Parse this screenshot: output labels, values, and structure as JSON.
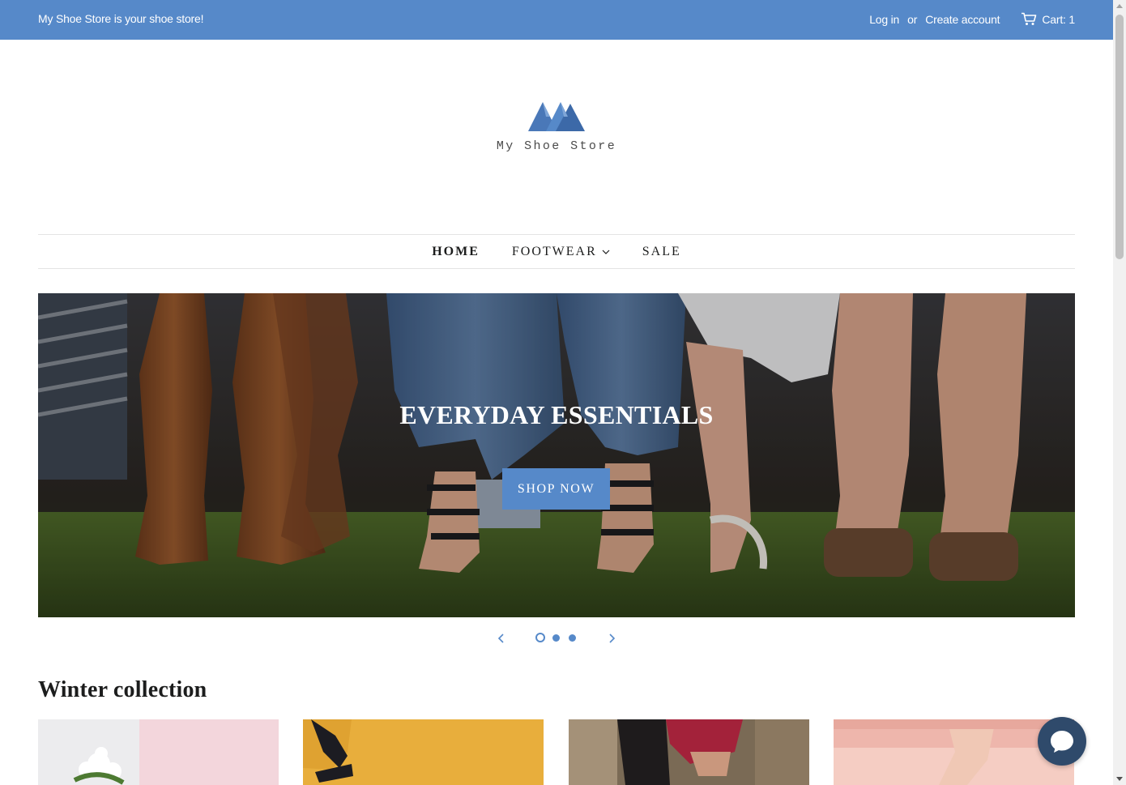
{
  "topbar": {
    "tagline": "My Shoe Store is your shoe store!",
    "login_label": "Log in",
    "or_label": "or",
    "create_account_label": "Create account",
    "cart_label": "Cart: 1",
    "background_color": "#5689c9"
  },
  "logo": {
    "text": "My Shoe Store",
    "icon": "mountain-logo-icon",
    "color": "#4a78b8"
  },
  "nav": {
    "items": [
      {
        "label": "HOME",
        "active": true
      },
      {
        "label": "FOOTWEAR",
        "has_dropdown": true
      },
      {
        "label": "SALE"
      }
    ]
  },
  "hero": {
    "headline": "EVERYDAY ESSENTIALS",
    "cta_label": "SHOP NOW",
    "slides_count": 3,
    "current_slide": 1
  },
  "collection": {
    "title": "Winter collection",
    "products_visible": 4
  },
  "colors": {
    "accent": "#5689c9",
    "text": "#1c1d1d",
    "chat": "#2f4a6b"
  }
}
